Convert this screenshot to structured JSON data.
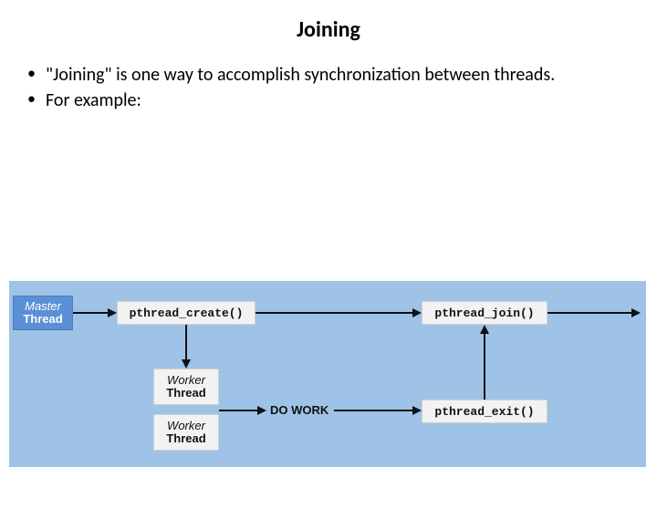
{
  "title": "Joining",
  "bullets": [
    "\"Joining\" is one way to accomplish synchronization between threads.",
    "For example:"
  ],
  "diagram": {
    "master": {
      "line1": "Master",
      "line2": "Thread"
    },
    "create": "pthread_create()",
    "join": "pthread_join()",
    "worker1": {
      "line1": "Worker",
      "line2": "Thread"
    },
    "worker2": {
      "line1": "Worker",
      "line2": "Thread"
    },
    "do_work": "DO WORK",
    "exit": "pthread_exit()"
  }
}
